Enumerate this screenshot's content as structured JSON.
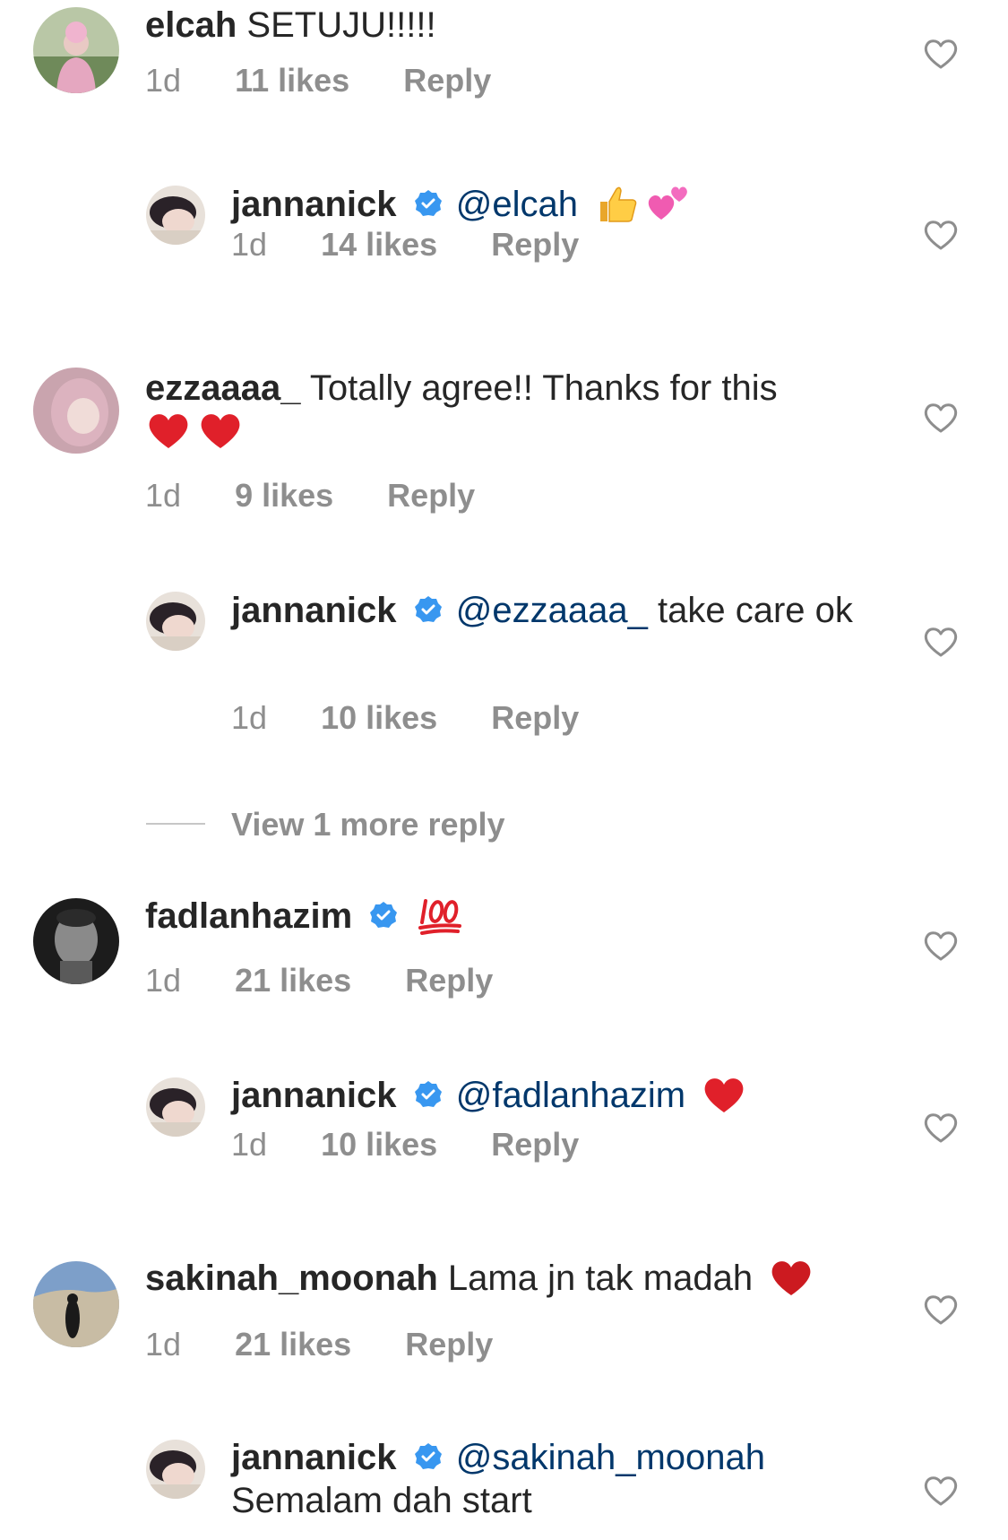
{
  "comments": [
    {
      "username": "elcah",
      "text": "SETUJU!!!!!",
      "time": "1d",
      "likes": "11 likes",
      "reply_label": "Reply",
      "verified": false
    },
    {
      "username": "jannanick",
      "mention": "@elcah",
      "text": "",
      "time": "1d",
      "likes": "14 likes",
      "reply_label": "Reply",
      "verified": true,
      "emojis": [
        "thumbs-up",
        "two-hearts"
      ]
    },
    {
      "username": "ezzaaaa_",
      "text": "Totally agree!! Thanks for this",
      "time": "1d",
      "likes": "9 likes",
      "reply_label": "Reply",
      "verified": false,
      "emojis": [
        "red-heart",
        "red-heart"
      ]
    },
    {
      "username": "jannanick",
      "mention": "@ezzaaaa_",
      "text": "take care ok",
      "time": "1d",
      "likes": "10 likes",
      "reply_label": "Reply",
      "verified": true
    },
    {
      "username": "fadlanhazim",
      "text": "",
      "time": "1d",
      "likes": "21 likes",
      "reply_label": "Reply",
      "verified": true,
      "emojis": [
        "hundred-points"
      ]
    },
    {
      "username": "jannanick",
      "mention": "@fadlanhazim",
      "text": "",
      "time": "1d",
      "likes": "10 likes",
      "reply_label": "Reply",
      "verified": true,
      "emojis": [
        "red-heart"
      ]
    },
    {
      "username": "sakinah_moonah",
      "text": "Lama jn tak madah",
      "time": "1d",
      "likes": "21 likes",
      "reply_label": "Reply",
      "verified": false,
      "emojis": [
        "red-heart"
      ]
    },
    {
      "username": "jannanick",
      "mention": "@sakinah_moonah",
      "text": "Semalam dah start",
      "verified": true
    }
  ],
  "view_more": "View 1 more reply",
  "colors": {
    "text": "#262626",
    "secondary": "#8e8e8e",
    "mention": "#00376b",
    "verified": "#3897f0"
  }
}
